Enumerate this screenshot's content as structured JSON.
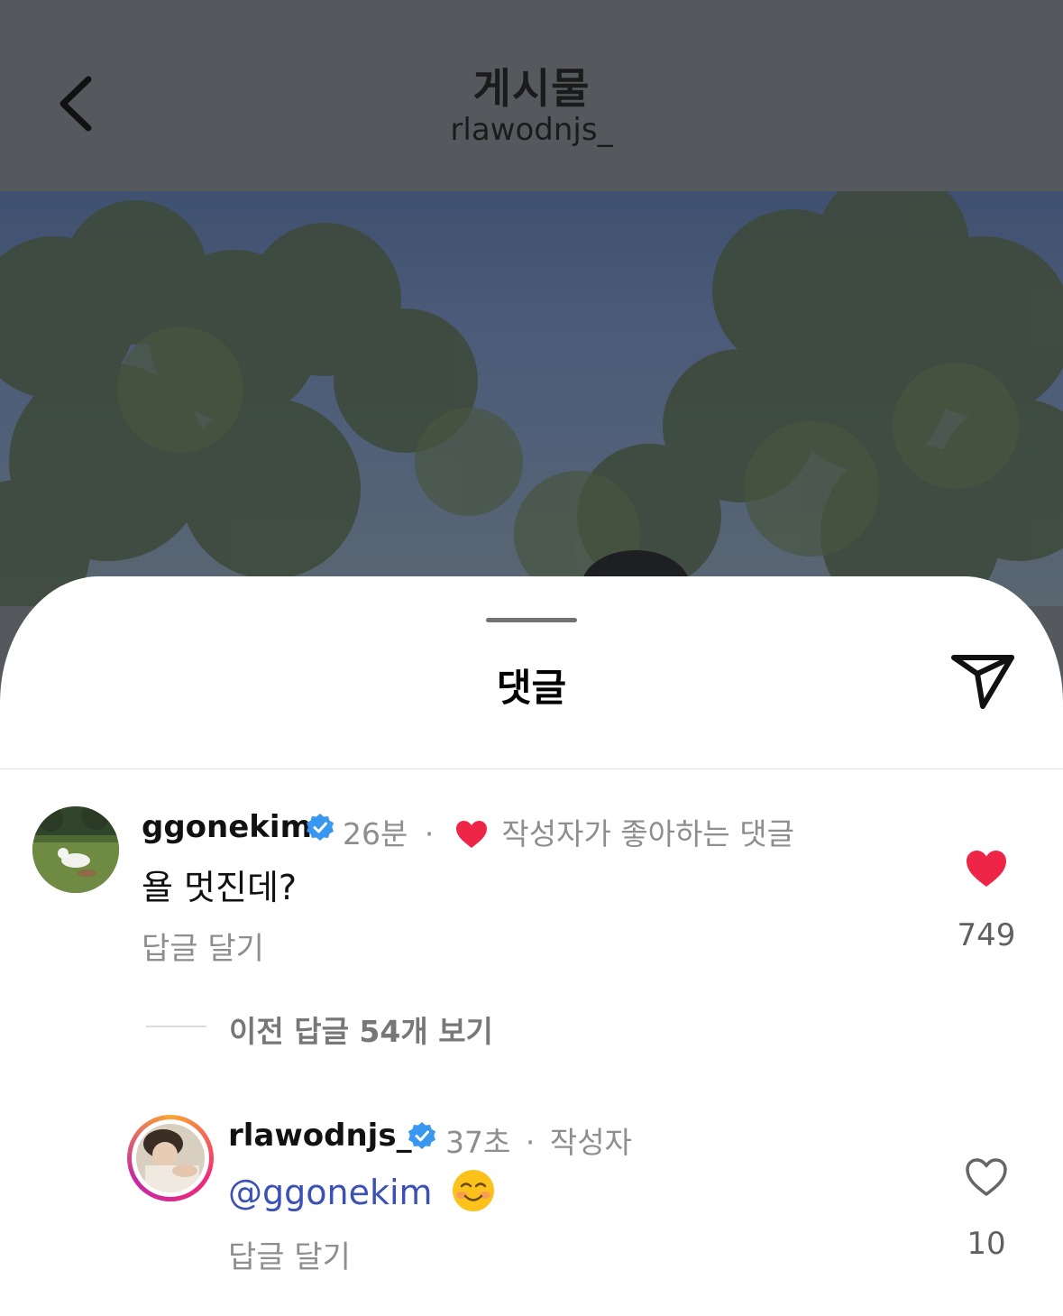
{
  "header": {
    "title": "게시물",
    "subtitle": "rlawodnjs_",
    "back_icon": "chevron-left-icon"
  },
  "sheet": {
    "title": "댓글",
    "share_icon": "paper-plane-icon"
  },
  "comments": [
    {
      "username": "ggonekim",
      "verified": true,
      "time": "26분",
      "dot": "·",
      "creator_liked_text": "작성자가 좋아하는 댓글",
      "text": "욜 멋진데?",
      "reply_label": "답글 달기",
      "likes": "749",
      "liked": true
    }
  ],
  "view_replies": {
    "label": "이전 답글 54개 보기"
  },
  "replies": [
    {
      "username": "rlawodnjs_",
      "verified": true,
      "time": "37초",
      "dot": "·",
      "author_label": "작성자",
      "mention": "@ggonekim",
      "emoji": "smiling-face-emoji",
      "reply_label": "답글 달기",
      "likes": "10",
      "liked": false
    }
  ],
  "colors": {
    "like_red": "#ee2547",
    "verified_blue": "#3897f0",
    "mention_blue": "#3b51b5",
    "overlay_gray": "#55595d"
  }
}
